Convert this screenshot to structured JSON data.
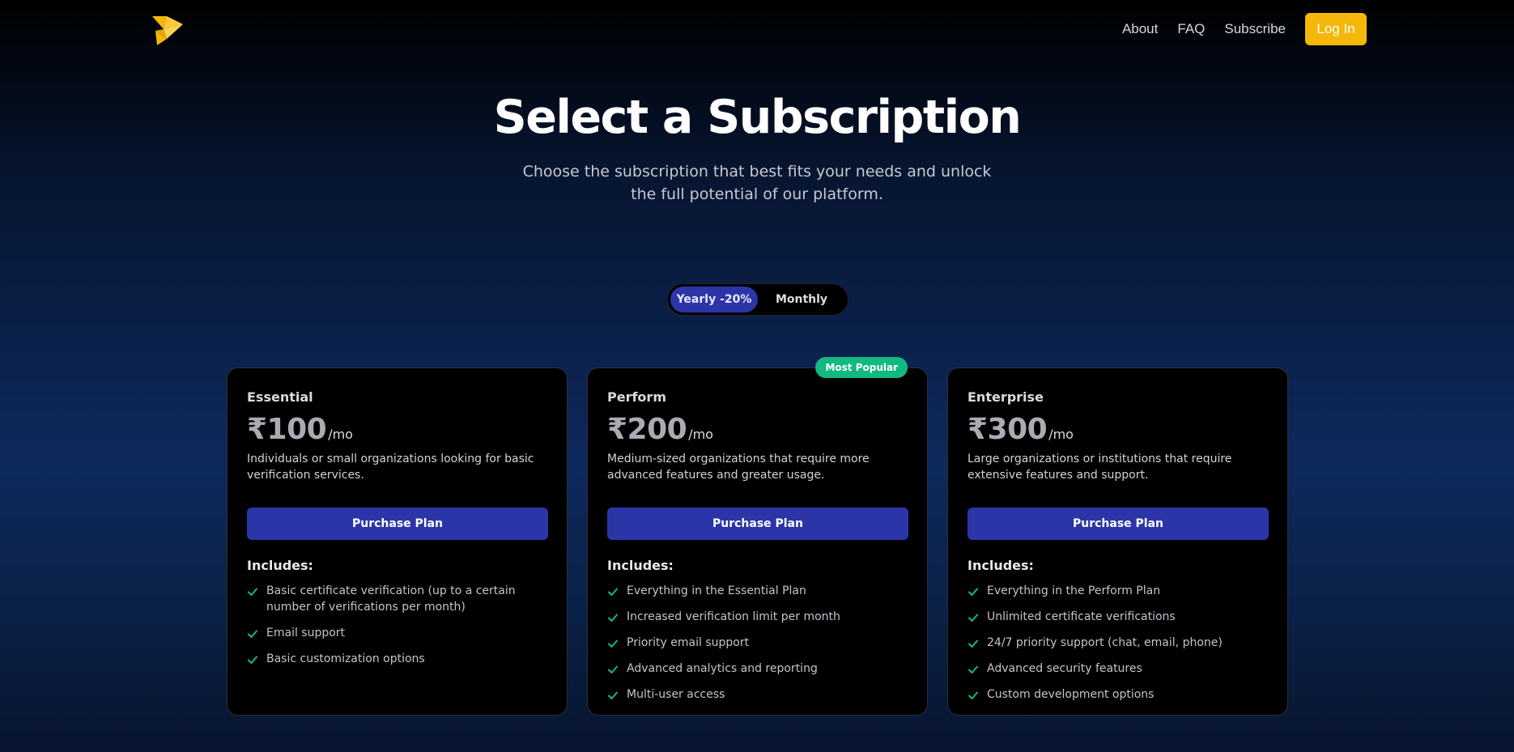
{
  "nav": {
    "links": [
      "About",
      "FAQ",
      "Subscribe"
    ],
    "login_label": "Log In"
  },
  "hero": {
    "title": "Select a Subscription",
    "subtitle": "Choose the subscription that best fits your needs and unlock the full potential of our platform."
  },
  "billing_toggle": {
    "options": [
      "Yearly -20%",
      "Monthly"
    ],
    "selected": "Yearly -20%"
  },
  "plans": [
    {
      "name": "Essential",
      "price": "₹100",
      "period": "/mo",
      "description": "Individuals or small organizations looking for basic verification services.",
      "button": "Purchase Plan",
      "includes_label": "Includes:",
      "features": [
        "Basic certificate verification (up to a certain number of verifications per month)",
        "Email support",
        "Basic customization options"
      ]
    },
    {
      "name": "Perform",
      "price": "₹200",
      "period": "/mo",
      "badge": "Most Popular",
      "description": "Medium-sized organizations that require more advanced features and greater usage.",
      "button": "Purchase Plan",
      "includes_label": "Includes:",
      "features": [
        "Everything in the Essential Plan",
        "Increased verification limit per month",
        "Priority email support",
        "Advanced analytics and reporting",
        "Multi-user access"
      ]
    },
    {
      "name": "Enterprise",
      "price": "₹300",
      "period": "/mo",
      "description": "Large organizations or institutions that require extensive features and support.",
      "button": "Purchase Plan",
      "includes_label": "Includes:",
      "features": [
        "Everything in the Perform Plan",
        "Unlimited certificate verifications",
        "24/7 priority support (chat, email, phone)",
        "Advanced security features",
        "Custom development options"
      ]
    }
  ],
  "colors": {
    "accent": "#2c35a8",
    "login": "#f4b70a",
    "badge": "#12b981",
    "check": "#12b981"
  },
  "icons": {
    "logo": "bird-logo-icon",
    "feature": "check-icon"
  }
}
